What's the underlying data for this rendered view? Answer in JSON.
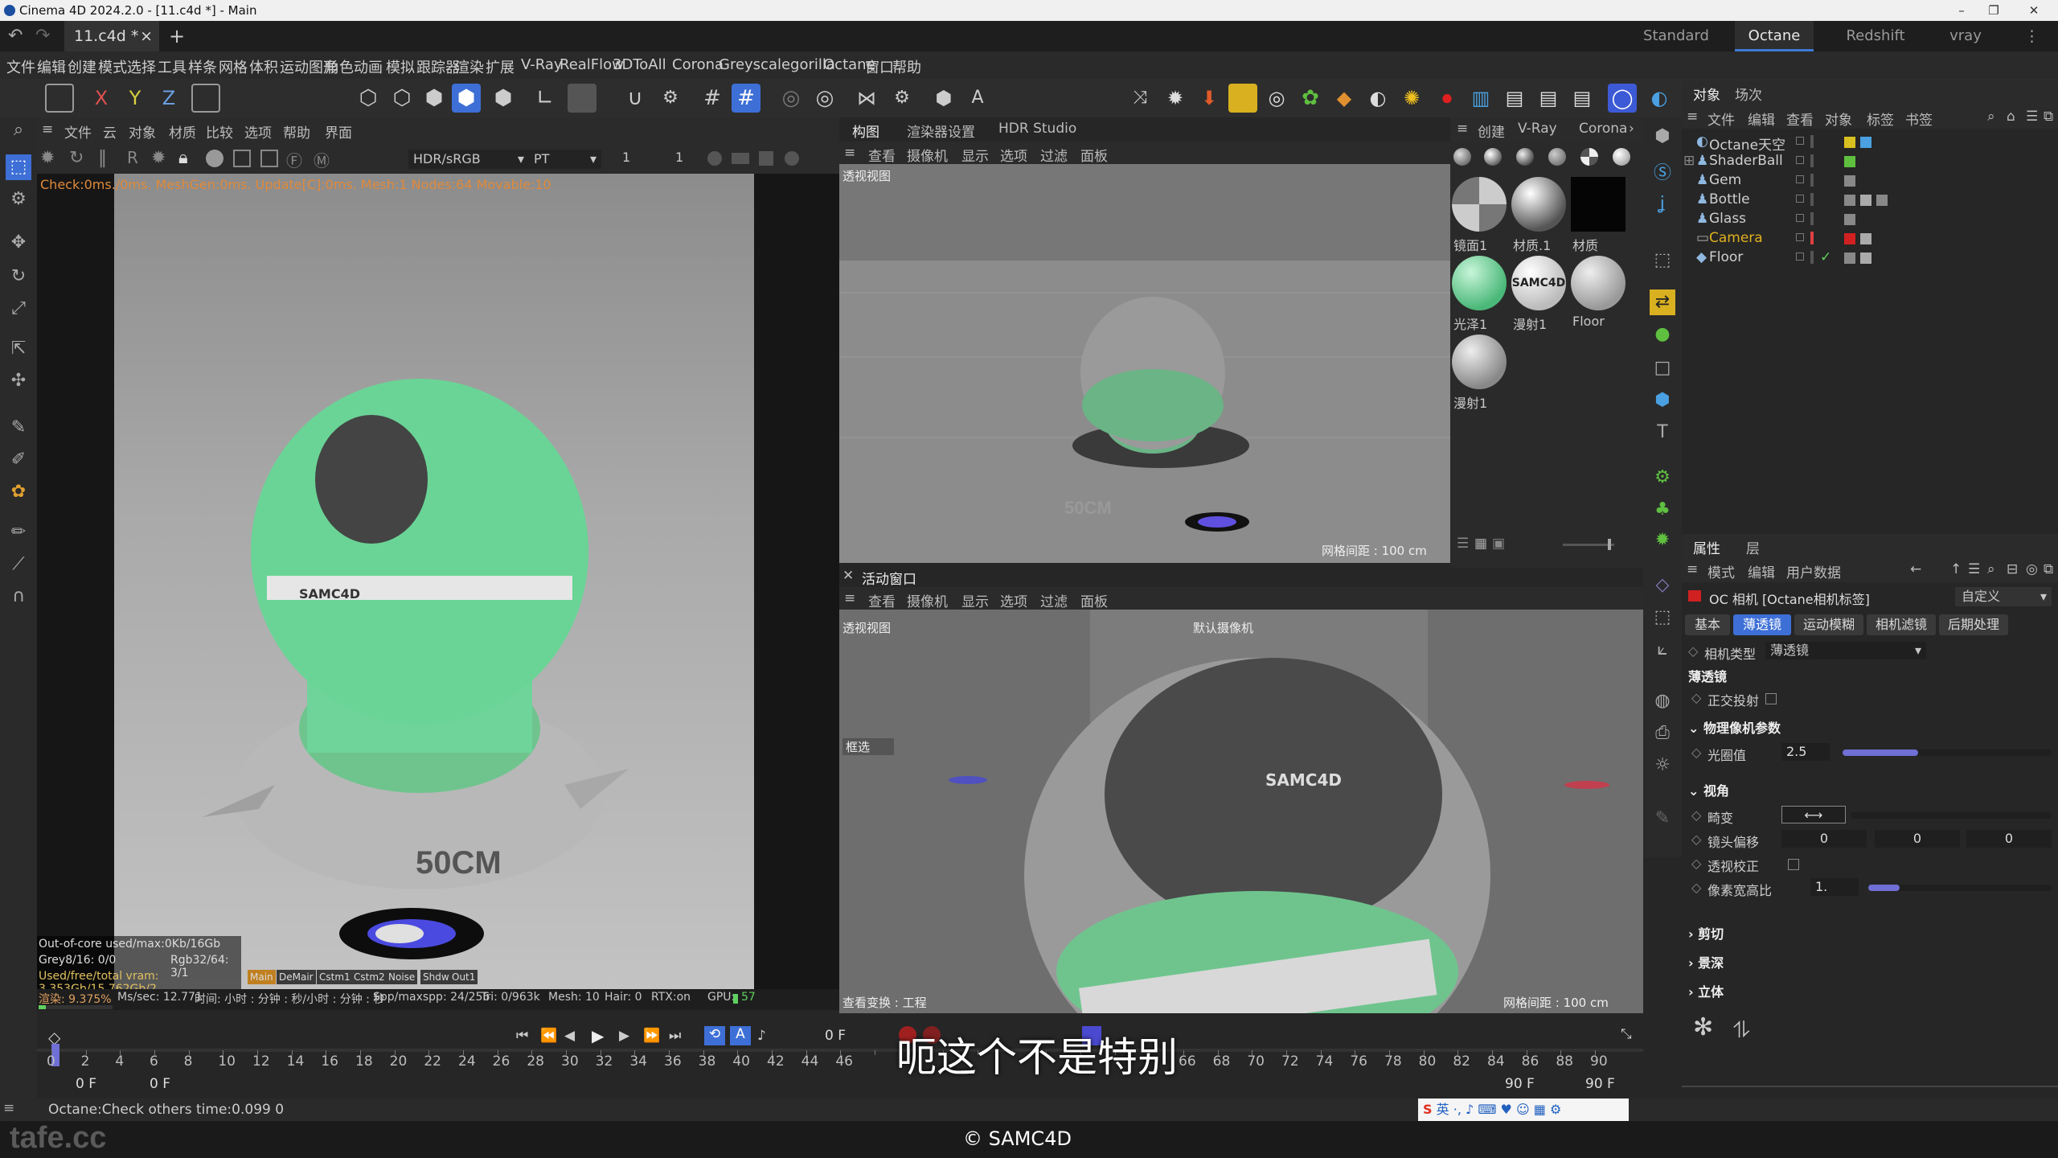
{
  "window": {
    "title": "Cinema 4D 2024.2.0 - [11.c4d *] - Main"
  },
  "tabs": {
    "doc": "11.c4d *",
    "close": "×",
    "add": "+"
  },
  "layouts": [
    "Standard",
    "Octane",
    "Redshift",
    "vray"
  ],
  "menu": [
    "文件",
    "编辑",
    "创建",
    "模式",
    "选择",
    "工具",
    "样条",
    "网格",
    "体积",
    "运动图形",
    "角色",
    "动画",
    "模拟",
    "跟踪器",
    "渲染",
    "扩展",
    "V-Ray",
    "RealFlow",
    "3DToAll",
    "Corona",
    "Greyscalegorilla",
    "Octane",
    "窗口",
    "帮助"
  ],
  "axes": {
    "x": "X",
    "y": "Y",
    "z": "Z"
  },
  "left_panel": {
    "menu": [
      "文件",
      "云",
      "对象",
      "材质",
      "比较",
      "选项",
      "帮助",
      "界面"
    ],
    "color_space": "HDR/sRGB",
    "mode": "PT",
    "val1": "1",
    "val2": "1",
    "status": "Check:0ms./0ms. MeshGen:0ms. Update[C]:0ms. Mesh:1 Nodes:64 Movable:10",
    "floor_text": "50CM",
    "sphere_text": "SAMC4D",
    "stats": {
      "outofcore": "Out-of-core used/max:0Kb/16Gb",
      "grey": "Grey8/16: 0/0",
      "rgb": "Rgb32/64: 3/1",
      "vram": "Used/free/total vram: 3.353Gb/15.762Gb/2",
      "chips": [
        "Main",
        "DeMair",
        "Cstm1",
        "Cstm2",
        "Noise",
        "Shdw",
        "Out1"
      ],
      "render": "渲染: 9.375%",
      "ms": "Ms/sec: 12.771",
      "time": "时间: 小时 : 分钟 : 秒/小时 : 分钟 : 秒",
      "spp": "Spp/maxspp: 24/256",
      "tri": "Tri: 0/963k",
      "mesh": "Mesh: 10",
      "hair": "Hair: 0",
      "rtx": "RTX:on",
      "gpu": "GPU:",
      "gpu_val": "57"
    }
  },
  "viewport_top": {
    "tabs": [
      "构图",
      "渲染器设置",
      "HDR Studio"
    ],
    "menu": [
      "查看",
      "摄像机",
      "显示",
      "选项",
      "过滤",
      "面板"
    ],
    "label": "透视视图",
    "grid": "网格间距 : 100 cm",
    "floor_text": "50CM"
  },
  "viewport_bottom": {
    "title": "活动窗口",
    "menu": [
      "查看",
      "摄像机",
      "显示",
      "选项",
      "过滤",
      "面板"
    ],
    "label": "透视视图",
    "camera": "默认摄像机",
    "select": "框选",
    "transform": "查看变换 : 工程",
    "grid": "网格间距 : 100 cm",
    "sphere_text": "SAMC4D"
  },
  "materials": {
    "menu": [
      "创建",
      "V-Ray",
      "Corona"
    ],
    "items": [
      {
        "name": "镜面1"
      },
      {
        "name": "材质.1"
      },
      {
        "name": "材质"
      },
      {
        "name": "光泽1"
      },
      {
        "name": "漫射1"
      },
      {
        "name": "Floor"
      },
      {
        "name": "漫射1"
      }
    ]
  },
  "objects": {
    "tabs": [
      "对象",
      "场次"
    ],
    "menu": [
      "文件",
      "编辑",
      "查看",
      "对象",
      "标签",
      "书签"
    ],
    "items": [
      {
        "name": "Octane天空"
      },
      {
        "name": "ShaderBall"
      },
      {
        "name": "Gem"
      },
      {
        "name": "Bottle"
      },
      {
        "name": "Glass"
      },
      {
        "name": "Camera"
      },
      {
        "name": "Floor"
      }
    ]
  },
  "attributes": {
    "tabs": [
      "属性",
      "层"
    ],
    "menu": [
      "模式",
      "编辑",
      "用户数据"
    ],
    "title": "OC 相机 [Octane相机标签]",
    "preset": "自定义",
    "subtabs": [
      "基本",
      "薄透镜",
      "运动模糊",
      "相机滤镜",
      "后期处理"
    ],
    "camera_type_label": "相机类型",
    "camera_type": "薄透镜",
    "section": "薄透镜",
    "ortho": "正交投射",
    "physical": "物理像机参数",
    "aperture_label": "光圈值",
    "aperture": "2.5",
    "aperture_level": 0.36,
    "view": "视角",
    "distortion": "畸变",
    "lens_shift": "镜头偏移",
    "shift_vals": [
      "0",
      "0",
      "0"
    ],
    "persp_correct": "透视校正",
    "pixel_aspect_label": "像素宽高比",
    "pixel_aspect": "1.",
    "pixel_aspect_level": 0.17,
    "collapsed": [
      "剪切",
      "景深",
      "立体"
    ]
  },
  "timeline": {
    "frame": "0 F",
    "start": "0 F",
    "start2": "0 F",
    "end": "90 F",
    "end2": "90 F",
    "ticks": [
      "0",
      "2",
      "4",
      "6",
      "8",
      "10",
      "12",
      "14",
      "16",
      "18",
      "20",
      "22",
      "24",
      "26",
      "28",
      "30",
      "32",
      "34",
      "36",
      "38",
      "40",
      "42",
      "44",
      "46",
      "",
      "",
      "",
      "",
      "",
      "",
      "",
      "",
      "",
      "66",
      "68",
      "70",
      "72",
      "74",
      "76",
      "78",
      "80",
      "82",
      "84",
      "86",
      "88",
      "90"
    ]
  },
  "statusbar": {
    "text": "Octane:Check others time:0.099  0"
  },
  "subtitle": "呃这个不是特别",
  "watermark": "tafe.cc",
  "copyright": "© SAMC4D",
  "ime": "英",
  "colors": {
    "accent": "#3d7bd6",
    "green": "#5fd08c",
    "slider": "#6f6fd6",
    "status": "#e08a3a"
  }
}
